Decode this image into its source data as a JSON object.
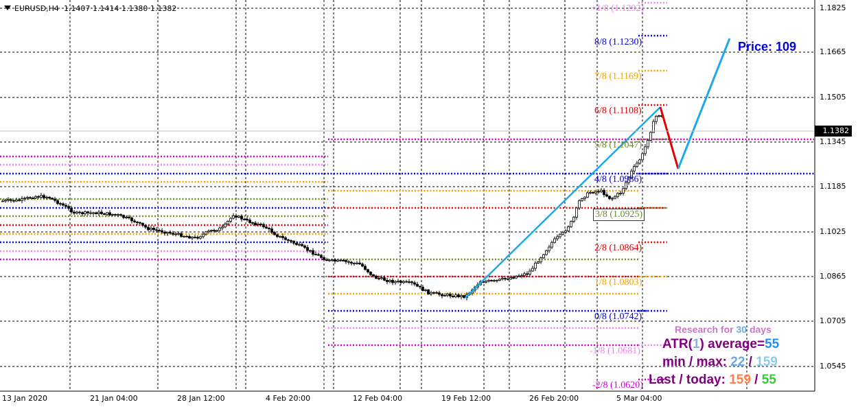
{
  "header": {
    "symbol": "EURUSD,H4",
    "ohlc": "1.1407 1.1414 1.1380 1.1382"
  },
  "current_price": "1.1382",
  "price_label": "Price: 109",
  "y_axis_ticks": [
    "1.1825",
    "1.1665",
    "1.1505",
    "1.1345",
    "1.1185",
    "1.1025",
    "1.0865",
    "1.0705",
    "1.0545"
  ],
  "x_axis_ticks": [
    "13 Jan 2020",
    "21 Jan 04:00",
    "28 Jan 12:00",
    "4 Feb 20:00",
    "12 Feb 04:00",
    "19 Feb 12:00",
    "26 Feb 20:00",
    "5 Mar 04:00"
  ],
  "murrey_levels": [
    {
      "label": "+1/8 (1.1292)",
      "color": "#ee82ee"
    },
    {
      "label": "8/8 (1.1230)",
      "color": "#0000cd"
    },
    {
      "label": "7/8 (1.1169)",
      "color": "#f5a000"
    },
    {
      "label": "6/8 (1.1108)",
      "color": "#e00000"
    },
    {
      "label": "5/8 (1.1047)",
      "color": "#6b8e23"
    },
    {
      "label": "4/8 (1.0986)",
      "color": "#0000cd"
    },
    {
      "label": "3/8 (1.0925)",
      "color": "#6b8e23"
    },
    {
      "label": "2/8 (1.0864)",
      "color": "#e00000"
    },
    {
      "label": "1/8 (1.0803)",
      "color": "#f5a000"
    },
    {
      "label": "0/8 (1.0742)",
      "color": "#0000cd"
    },
    {
      "label": "-1/8 (1.0681)",
      "color": "#ee82ee"
    },
    {
      "label": "-2/8 (1.0620)",
      "color": "#cc00cc"
    }
  ],
  "stats": {
    "research_prefix": "Research for ",
    "research_days": "30",
    "research_suffix": " days",
    "atr_prefix": "ATR(",
    "atr_period": "1",
    "atr_mid": ") average=",
    "atr_average": "55",
    "minmax_label": "min / max: ",
    "min": "22",
    "sep1": " / ",
    "max": "159",
    "last_label": "Last / today: ",
    "last": "159",
    "sep2": " / ",
    "today": "55"
  },
  "colors": {
    "trend_up": "#1aa9e8",
    "trend_down": "#e00000",
    "violet": "#cc00cc",
    "pink": "#ee82ee",
    "blue": "#0000cd",
    "orange": "#f5a000",
    "red": "#e00000",
    "olive": "#6b8e23"
  }
}
